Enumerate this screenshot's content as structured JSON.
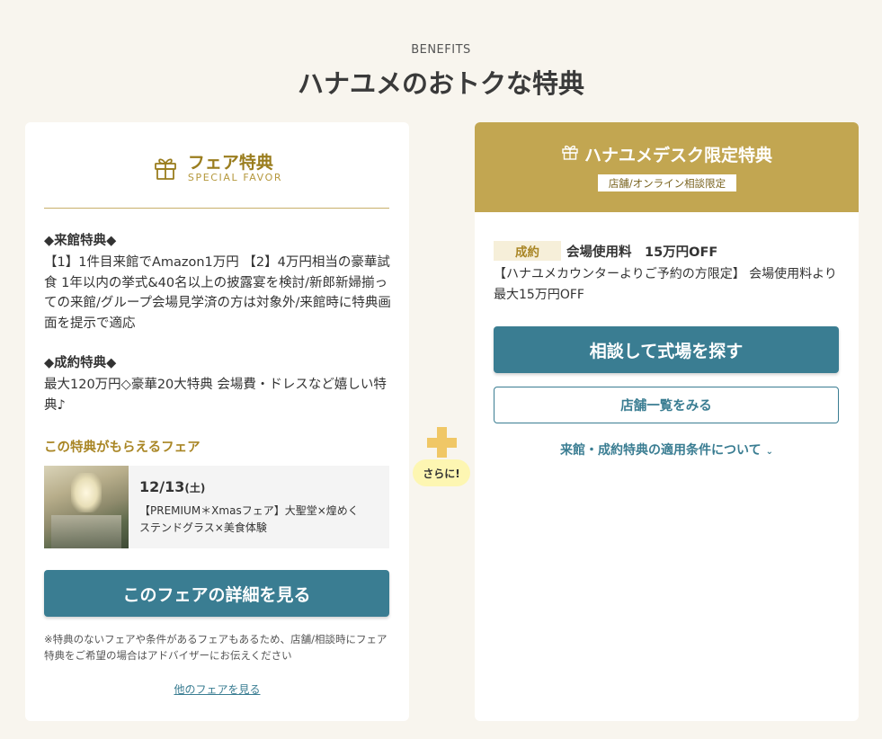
{
  "header": {
    "eyebrow": "BENEFITS",
    "title": "ハナユメのおトクな特典"
  },
  "fair_card": {
    "title": "フェア特典",
    "subtitle": "SPECIAL FAVOR",
    "visit_heading": "◆来館特典◆",
    "visit_body": "【1】1件目来館でAmazon1万円 【2】4万円相当の豪華試食 1年以内の挙式&40名以上の披露宴を検討/新郎新婦揃っての来館/グループ会場見学済の方は対象外/来館時に特典画面を提示で適応",
    "contract_heading": "◆成約特典◆",
    "contract_body": "最大120万円◇豪華20大特典 会場費・ドレスなど嬉しい特典♪",
    "fair_label": "この特典がもらえるフェア",
    "fair_date": "12/13",
    "fair_day": "(土)",
    "fair_name": "【PREMIUM＊Xmasフェア】大聖堂×煌めくステンドグラス×美食体験",
    "cta": "このフェアの詳細を見る",
    "note": "※特典のないフェアや条件があるフェアもあるため、店舗/相談時にフェア特典をご希望の場合はアドバイザーにお伝えください",
    "other_link": "他のフェアを見る"
  },
  "connector": {
    "badge": "さらに!"
  },
  "desk_card": {
    "title": "ハナユメデスク限定特典",
    "tag": "店舗/オンライン相談限定",
    "badge": "成約",
    "headline": "会場使用料　15万円OFF",
    "desc": "【ハナユメカウンターよりご予約の方限定】 会場使用料より最大15万円OFF",
    "cta_consult": "相談して式場を探す",
    "cta_stores": "店舗一覧をみる",
    "conditions_link": "来館・成約特典の適用条件について",
    "conditions_chevron": "⌄"
  },
  "colors": {
    "background": "#f8f5ee",
    "gold": "#c2a651",
    "gold_text": "#a98625",
    "teal": "#3a7d92",
    "plus_yellow": "#f0c766",
    "badge_yellow": "#fdf6b2"
  },
  "icons": {
    "fair_gift": "gift-icon",
    "desk_gift": "gift-icon",
    "plus": "plus-icon",
    "chevron": "chevron-down-icon"
  }
}
